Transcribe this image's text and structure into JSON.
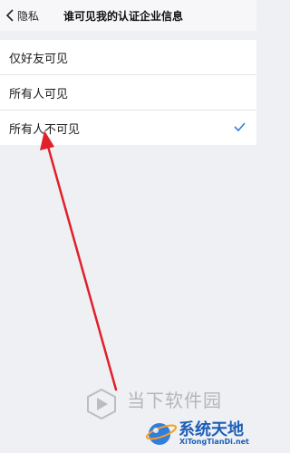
{
  "navbar": {
    "back_label": "隐私",
    "title": "谁可见我的认证企业信息"
  },
  "options": [
    {
      "label": "仅好友可见",
      "selected": false
    },
    {
      "label": "所有人可见",
      "selected": false
    },
    {
      "label": "所有人不可见",
      "selected": true
    }
  ],
  "colors": {
    "accent": "#2f7de1",
    "arrow": "#e0202a",
    "background": "#eff0f4"
  },
  "watermarks": {
    "site1": "当下软件园",
    "site2_name": "系统天地",
    "site2_url": "XiTongTianDi.net"
  }
}
